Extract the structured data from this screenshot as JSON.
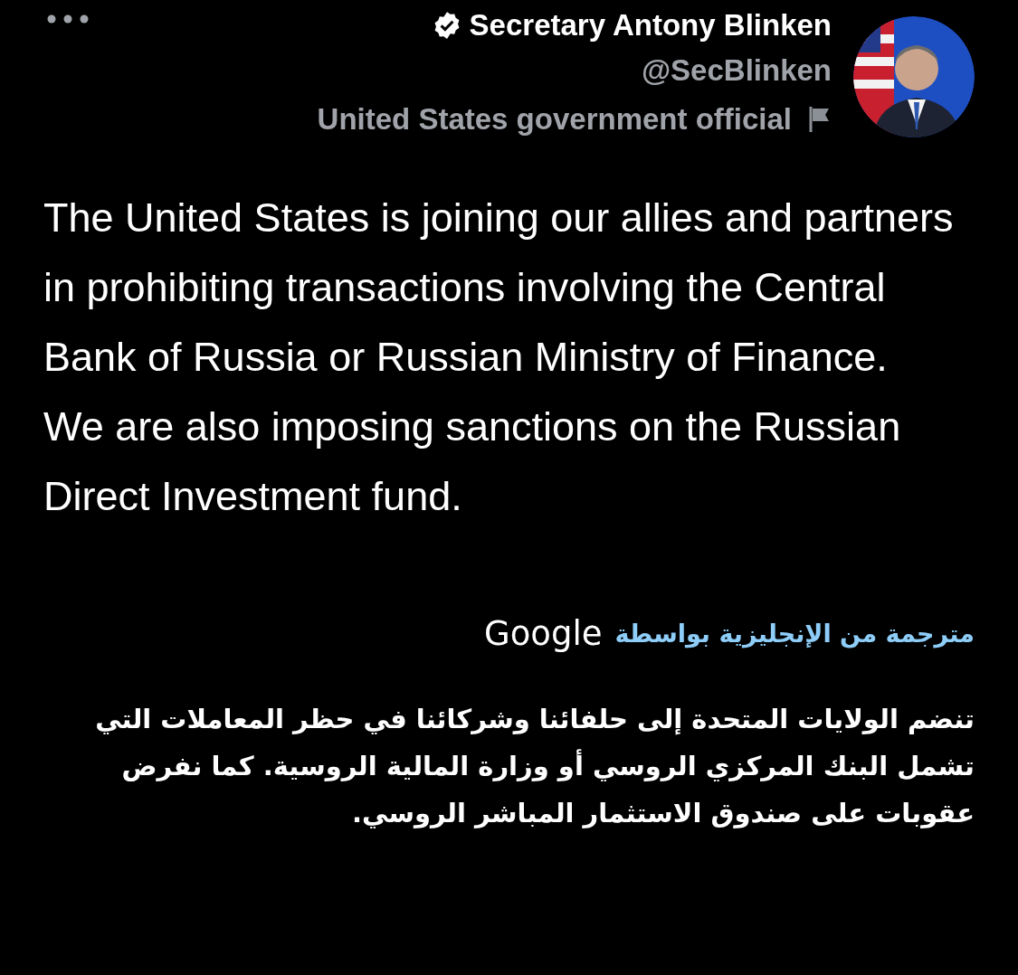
{
  "author": {
    "name": "Secretary Antony Blinken",
    "verified": true,
    "handle": "@SecBlinken",
    "label": "United States government official"
  },
  "tweet": {
    "text": "The United States is joining our allies and partners in prohibiting transactions involving the Central Bank of Russia or Russian Ministry of Finance. We are also imposing sanctions on the Russian Direct Investment fund."
  },
  "translation": {
    "note": "مترجمة من الإنجليزية بواسطة",
    "provider": "Google",
    "text": "تنضم الولايات المتحدة إلى حلفائنا وشركائنا في حظر المعاملات التي تشمل البنك المركزي الروسي أو وزارة المالية الروسية. كما نفرض عقوبات على صندوق الاستثمار المباشر الروسي."
  }
}
